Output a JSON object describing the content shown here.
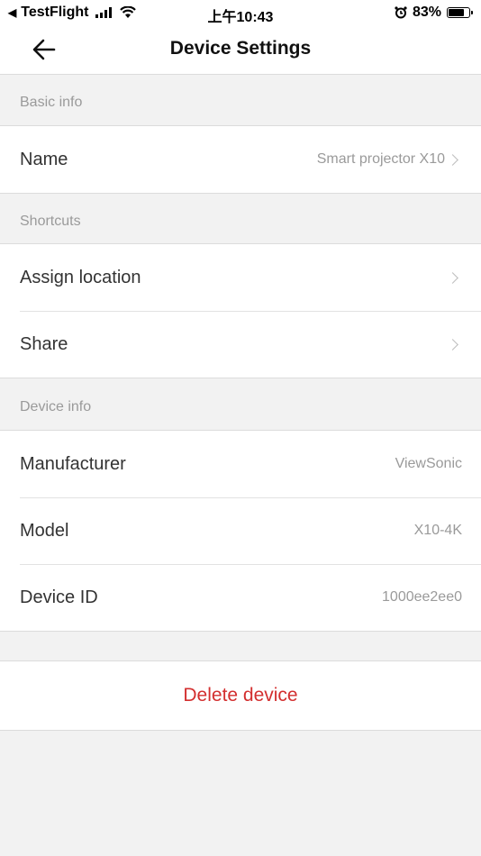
{
  "status_bar": {
    "back_app": "TestFlight",
    "time": "上午10:43",
    "battery": "83%",
    "battery_level": 0.83
  },
  "header": {
    "title": "Device Settings"
  },
  "sections": {
    "basic": {
      "title": "Basic info",
      "name_label": "Name",
      "name_value": "Smart projector X10"
    },
    "shortcuts": {
      "title": "Shortcuts",
      "assign_label": "Assign location",
      "share_label": "Share"
    },
    "device": {
      "title": "Device info",
      "manufacturer_label": "Manufacturer",
      "manufacturer_value": "ViewSonic",
      "model_label": "Model",
      "model_value": "X10-4K",
      "id_label": "Device ID",
      "id_value": "1000ee2ee0"
    }
  },
  "actions": {
    "delete_label": "Delete device"
  },
  "colors": {
    "danger": "#d32f2f",
    "secondary_text": "#9a9a9a",
    "background": "#f2f2f2"
  },
  "icons": [
    "back-arrow-icon",
    "chevron-right-icon",
    "signal-icon",
    "wifi-icon",
    "alarm-icon",
    "battery-icon"
  ]
}
